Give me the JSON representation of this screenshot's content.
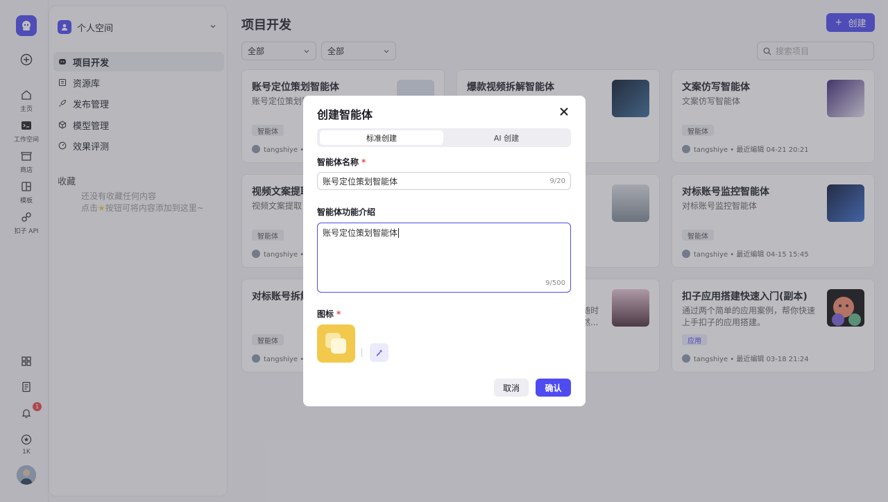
{
  "rail": {
    "items": [
      {
        "label": "主页",
        "icon": "home-icon"
      },
      {
        "label": "工作空间",
        "icon": "terminal-icon"
      },
      {
        "label": "商店",
        "icon": "store-icon"
      },
      {
        "label": "模板",
        "icon": "template-icon"
      },
      {
        "label": "扣子 API",
        "icon": "api-icon"
      }
    ],
    "notifications_count": "1",
    "stars": "1K"
  },
  "sidebar": {
    "space_name": "个人空间",
    "nav": [
      {
        "label": "项目开发"
      },
      {
        "label": "资源库"
      },
      {
        "label": "发布管理"
      },
      {
        "label": "模型管理"
      },
      {
        "label": "效果评测"
      }
    ],
    "favorites_title": "收藏",
    "favorites_empty_1": "还没有收藏任何内容",
    "favorites_empty_2": "点击",
    "favorites_empty_3": "按钮可将内容添加到这里~"
  },
  "main": {
    "title": "项目开发",
    "create_label": "创建",
    "filter1": "全部",
    "filter2": "全部",
    "search_placeholder": "搜索项目"
  },
  "cards": [
    {
      "title": "账号定位策划智能体",
      "desc": "账号定位策划智能体",
      "tag": "智能体",
      "meta": "tangshiye • 最"
    },
    {
      "title": "爆款视频拆解智能体",
      "desc": "",
      "tag": "",
      "meta": ""
    },
    {
      "title": "文案仿写智能体",
      "desc": "文案仿写智能体",
      "tag": "智能体",
      "meta": "tangshiye • 最近编辑 04-21 20:21"
    },
    {
      "title": "视频文案提取",
      "desc": "视频文案提取",
      "tag": "智能体",
      "meta": "tangshiye • 最"
    },
    {
      "title": "",
      "desc": "",
      "tag": "",
      "meta": ""
    },
    {
      "title": "对标账号监控智能体",
      "desc": "对标账号监控智能体",
      "tag": "智能体",
      "meta": "tangshiye • 最近编辑 04-15 15:45"
    },
    {
      "title": "对标账号拆解",
      "desc": "",
      "tag": "智能体",
      "meta": "tangshiye • 最"
    },
    {
      "title": "",
      "desc": "随时 然...",
      "tag": "",
      "meta": ""
    },
    {
      "title": "扣子应用搭建快速入门(副本)",
      "desc": "通过两个简单的应用案例，帮你快速上手扣子的应用搭建。",
      "tag": "应用",
      "meta": "tangshiye • 最近编辑 03-18 21:24"
    }
  ],
  "modal": {
    "title": "创建智能体",
    "tab_standard": "标准创建",
    "tab_ai": "AI 创建",
    "name_label": "智能体名称",
    "required_mark": "*",
    "name_value": "账号定位策划智能体",
    "name_counter": "9/20",
    "desc_label": "智能体功能介绍",
    "desc_value": "账号定位策划智能体",
    "desc_counter": "9/500",
    "icon_label": "图标",
    "cancel_label": "取消",
    "confirm_label": "确认"
  },
  "colors": {
    "accent": "#4e4bf0",
    "required": "#e5484d",
    "icon_bg": "#f2c94c"
  }
}
